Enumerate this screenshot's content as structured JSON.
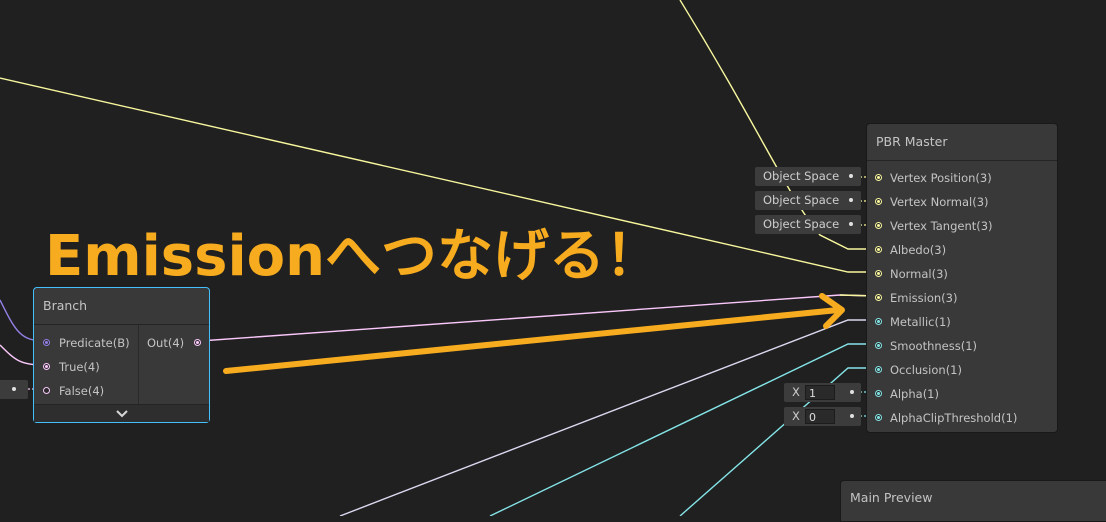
{
  "annotation": "Emissionへつなげる！",
  "branch_node": {
    "title": "Branch",
    "inputs": [
      "Predicate(B)",
      "True(4)",
      "False(4)"
    ],
    "output": "Out(4)",
    "expand_icon": "chevron-down-icon"
  },
  "pbr_master": {
    "title": "PBR Master",
    "inputs": [
      "Vertex Position(3)",
      "Vertex Normal(3)",
      "Vertex Tangent(3)",
      "Albedo(3)",
      "Normal(3)",
      "Emission(3)",
      "Metallic(1)",
      "Smoothness(1)",
      "Occlusion(1)",
      "Alpha(1)",
      "AlphaClipThreshold(1)"
    ]
  },
  "space_chips": [
    "Object Space",
    "Object Space",
    "Object Space"
  ],
  "alpha_field": {
    "axis": "X",
    "value": "1"
  },
  "alpha_clip_field": {
    "axis": "X",
    "value": "0"
  },
  "main_preview": {
    "title": "Main Preview"
  },
  "colors": {
    "vector3": "#f8f79e",
    "vector1": "#84e4e7",
    "vector4": "#fbc8fb",
    "boolean": "#9481e6",
    "annotation": "#f7ab1f",
    "selection": "#44c0ff"
  }
}
